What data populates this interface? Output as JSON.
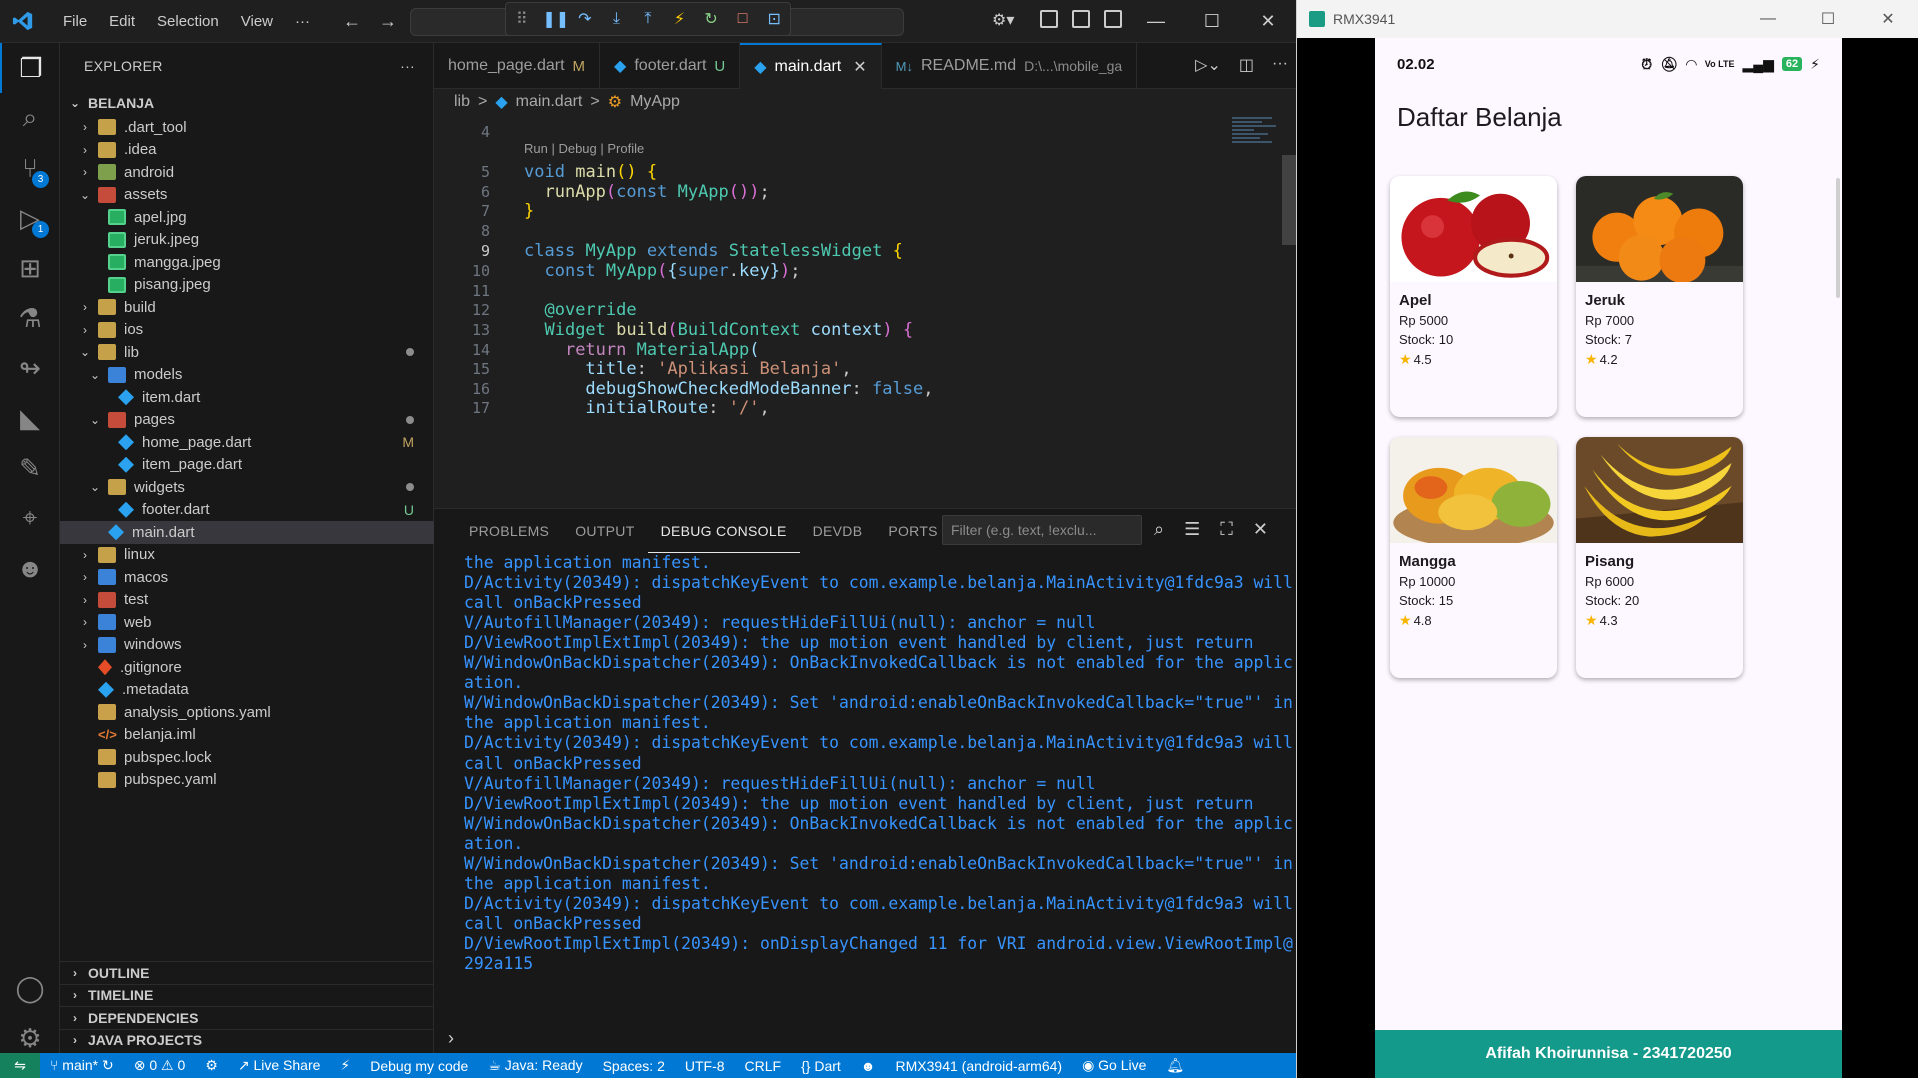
{
  "vscode": {
    "menu": [
      "File",
      "Edit",
      "Selection",
      "View",
      "···"
    ],
    "explorer": {
      "title": "EXPLORER",
      "root": "BELANJA",
      "items": [
        {
          "label": ".dart_tool",
          "depth": 1,
          "type": "folder",
          "open": false
        },
        {
          "label": ".idea",
          "depth": 1,
          "type": "folder",
          "open": false
        },
        {
          "label": "android",
          "depth": 1,
          "type": "folder-green",
          "open": false
        },
        {
          "label": "assets",
          "depth": 1,
          "type": "folder-red",
          "open": true
        },
        {
          "label": "apel.jpg",
          "depth": 2,
          "type": "img"
        },
        {
          "label": "jeruk.jpeg",
          "depth": 2,
          "type": "img"
        },
        {
          "label": "mangga.jpeg",
          "depth": 2,
          "type": "img"
        },
        {
          "label": "pisang.jpeg",
          "depth": 2,
          "type": "img"
        },
        {
          "label": "build",
          "depth": 1,
          "type": "folder",
          "open": false
        },
        {
          "label": "ios",
          "depth": 1,
          "type": "folder",
          "open": false
        },
        {
          "label": "lib",
          "depth": 1,
          "type": "folder",
          "open": true,
          "dot": true
        },
        {
          "label": "models",
          "depth": 2,
          "type": "folder-blue",
          "open": true
        },
        {
          "label": "item.dart",
          "depth": 3,
          "type": "dart"
        },
        {
          "label": "pages",
          "depth": 2,
          "type": "folder-red",
          "open": true,
          "dot": true
        },
        {
          "label": "home_page.dart",
          "depth": 3,
          "type": "dart",
          "status": "M"
        },
        {
          "label": "item_page.dart",
          "depth": 3,
          "type": "dart"
        },
        {
          "label": "widgets",
          "depth": 2,
          "type": "folder",
          "open": true,
          "dot": true
        },
        {
          "label": "footer.dart",
          "depth": 3,
          "type": "dart",
          "status": "U"
        },
        {
          "label": "main.dart",
          "depth": 2,
          "type": "dart",
          "selected": true
        },
        {
          "label": "linux",
          "depth": 1,
          "type": "folder",
          "open": false
        },
        {
          "label": "macos",
          "depth": 1,
          "type": "folder-blue",
          "open": false
        },
        {
          "label": "test",
          "depth": 1,
          "type": "folder-red",
          "open": false
        },
        {
          "label": "web",
          "depth": 1,
          "type": "folder-blue",
          "open": false
        },
        {
          "label": "windows",
          "depth": 1,
          "type": "folder-blue",
          "open": false
        },
        {
          "label": ".gitignore",
          "depth": 1,
          "type": "git"
        },
        {
          "label": ".metadata",
          "depth": 1,
          "type": "dart"
        },
        {
          "label": "analysis_options.yaml",
          "depth": 1,
          "type": "yaml"
        },
        {
          "label": "belanja.iml",
          "depth": 1,
          "type": "xml"
        },
        {
          "label": "pubspec.lock",
          "depth": 1,
          "type": "yaml"
        },
        {
          "label": "pubspec.yaml",
          "depth": 1,
          "type": "yaml"
        }
      ],
      "sections": [
        "OUTLINE",
        "TIMELINE",
        "DEPENDENCIES",
        "JAVA PROJECTS"
      ]
    },
    "tabs": [
      {
        "label": "home_page.dart",
        "mod": "M"
      },
      {
        "label": "footer.dart",
        "mod": "U"
      },
      {
        "label": "main.dart",
        "active": true
      },
      {
        "label": "README.md",
        "dir": "D:\\...\\mobile_ga"
      }
    ],
    "breadcrumb": [
      "lib",
      ">",
      "main.dart",
      ">",
      "MyApp"
    ],
    "codelens": "Run | Debug | Profile",
    "code_lines": [
      {
        "n": "4",
        "html": ""
      },
      {
        "n": "5",
        "html": "<span class='k'>void</span> <span class='f'>main</span><span class='b'>()</span> <span class='b'>{</span>"
      },
      {
        "n": "6",
        "html": "  <span class='f'>runApp</span><span class='pu'>(</span><span class='k'>const</span> <span class='c'>MyApp</span><span class='pu'>()</span><span class='pu'>)</span>;"
      },
      {
        "n": "7",
        "html": "<span class='b'>}</span>"
      },
      {
        "n": "8",
        "html": ""
      },
      {
        "n": "9",
        "html": "<span class='k'>class</span> <span class='c'>MyApp</span> <span class='k'>extends</span> <span class='c'>StatelessWidget</span> <span class='b'>{</span>",
        "cur": true
      },
      {
        "n": "10",
        "html": "  <span class='k'>const</span> <span class='c'>MyApp</span><span class='pu'>(</span><span class='p'>{</span><span class='k'>super</span>.<span class='p'>key</span><span class='p'>}</span><span class='pu'>)</span>;"
      },
      {
        "n": "11",
        "html": ""
      },
      {
        "n": "12",
        "html": "  <span class='c'>@override</span>"
      },
      {
        "n": "13",
        "html": "  <span class='c'>Widget</span> <span class='f'>build</span><span class='pu'>(</span><span class='c'>BuildContext</span> <span class='p'>context</span><span class='pu'>)</span> <span class='pu'>{</span>"
      },
      {
        "n": "14",
        "html": "    <span class='kw2'>return</span> <span class='c'>MaterialApp</span><span class='p'>(</span>"
      },
      {
        "n": "15",
        "html": "      <span class='p'>title</span>: <span class='s'>'Aplikasi Belanja'</span>,"
      },
      {
        "n": "16",
        "html": "      <span class='p'>debugShowCheckedModeBanner</span>: <span class='k'>false</span>,"
      },
      {
        "n": "17",
        "html": "      <span class='p'>initialRoute</span>: <span class='s'>'/'</span>,"
      }
    ],
    "panel_tabs": [
      "PROBLEMS",
      "OUTPUT",
      "DEBUG CONSOLE",
      "DEVDB",
      "PORTS",
      "···"
    ],
    "filter_placeholder": "Filter (e.g. text, !exclu...",
    "console_lines": [
      "the application manifest.",
      "D/Activity(20349): dispatchKeyEvent to com.example.belanja.MainActivity@1fdc9a3 will",
      "call onBackPressed",
      "V/AutofillManager(20349): requestHideFillUi(null): anchor = null",
      "D/ViewRootImplExtImpl(20349): the up motion event handled by client, just return",
      "W/WindowOnBackDispatcher(20349): OnBackInvokedCallback is not enabled for the applic",
      "ation.",
      "W/WindowOnBackDispatcher(20349): Set 'android:enableOnBackInvokedCallback=\"true\"' in",
      "the application manifest.",
      "D/Activity(20349): dispatchKeyEvent to com.example.belanja.MainActivity@1fdc9a3 will",
      "call onBackPressed",
      "V/AutofillManager(20349): requestHideFillUi(null): anchor = null",
      "D/ViewRootImplExtImpl(20349): the up motion event handled by client, just return",
      "W/WindowOnBackDispatcher(20349): OnBackInvokedCallback is not enabled for the applic",
      "ation.",
      "W/WindowOnBackDispatcher(20349): Set 'android:enableOnBackInvokedCallback=\"true\"' in",
      "the application manifest.",
      "D/Activity(20349): dispatchKeyEvent to com.example.belanja.MainActivity@1fdc9a3 will",
      "call onBackPressed",
      "D/ViewRootImplExtImpl(20349): onDisplayChanged 11 for VRI android.view.ViewRootImpl@",
      "292a115"
    ],
    "status": {
      "branch": "main*",
      "errors": "0",
      "warnings": "0",
      "live_share": "Live Share",
      "debug": "Debug my code",
      "java": "Java: Ready",
      "spaces": "Spaces: 2",
      "encoding": "UTF-8",
      "eol": "CRLF",
      "lang": "Dart",
      "device": "RMX3941 (android-arm64)",
      "golive": "Go Live"
    }
  },
  "emulator": {
    "title": "RMX3941",
    "time": "02.02",
    "battery": "62",
    "app_title": "Daftar Belanja",
    "products": [
      {
        "name": "Apel",
        "price": "Rp 5000",
        "stock": "Stock: 10",
        "rating": "4.5",
        "kind": "apple"
      },
      {
        "name": "Jeruk",
        "price": "Rp 7000",
        "stock": "Stock: 7",
        "rating": "4.2",
        "kind": "orange"
      },
      {
        "name": "Mangga",
        "price": "Rp 10000",
        "stock": "Stock: 15",
        "rating": "4.8",
        "kind": "mango"
      },
      {
        "name": "Pisang",
        "price": "Rp 6000",
        "stock": "Stock: 20",
        "rating": "4.3",
        "kind": "banana"
      }
    ],
    "footer": "Afifah Khoirunnisa - 2341720250"
  }
}
